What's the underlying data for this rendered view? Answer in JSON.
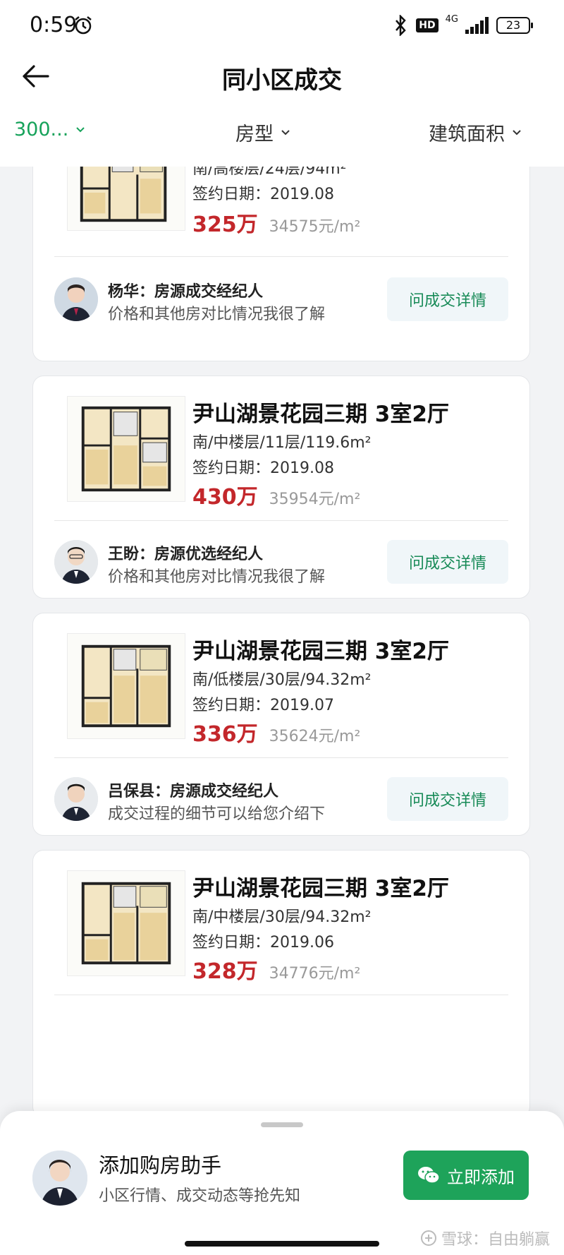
{
  "status_bar": {
    "time": "0:59",
    "hd": "HD",
    "network": "4G",
    "battery": "23"
  },
  "header": {
    "title": "同小区成交"
  },
  "filters": [
    {
      "label": "300...",
      "active": true
    },
    {
      "label": "房型",
      "active": false
    },
    {
      "label": "建筑面积",
      "active": false
    }
  ],
  "listings": [
    {
      "title": "",
      "meta": "南/高楼层/24层/94m²",
      "date": "签约日期：2019.08",
      "price": "325万",
      "unit_price": "34575元/m²",
      "agent_name": "杨华：房源成交经纪人",
      "agent_msg": "价格和其他房对比情况我很了解",
      "cta": "问成交详情"
    },
    {
      "title": "尹山湖景花园三期 3室2厅",
      "meta": "南/中楼层/11层/119.6m²",
      "date": "签约日期：2019.08",
      "price": "430万",
      "unit_price": "35954元/m²",
      "agent_name": "王盼：房源优选经纪人",
      "agent_msg": "价格和其他房对比情况我很了解",
      "cta": "问成交详情"
    },
    {
      "title": "尹山湖景花园三期 3室2厅",
      "meta": "南/低楼层/30层/94.32m²",
      "date": "签约日期：2019.07",
      "price": "336万",
      "unit_price": "35624元/m²",
      "agent_name": "吕保县：房源成交经纪人",
      "agent_msg": "成交过程的细节可以给您介绍下",
      "cta": "问成交详情"
    },
    {
      "title": "尹山湖景花园三期 3室2厅",
      "meta": "南/中楼层/30层/94.32m²",
      "date": "签约日期：2019.06",
      "price": "328万",
      "unit_price": "34776元/m²"
    }
  ],
  "bottom_sheet": {
    "title": "添加购房助手",
    "subtitle": "小区行情、成交动态等抢先知",
    "button": "立即添加"
  },
  "watermark": "雪球：自由躺赢",
  "colors": {
    "accent": "#1ea35a",
    "price": "#c3272b",
    "cta_text": "#178a57"
  }
}
